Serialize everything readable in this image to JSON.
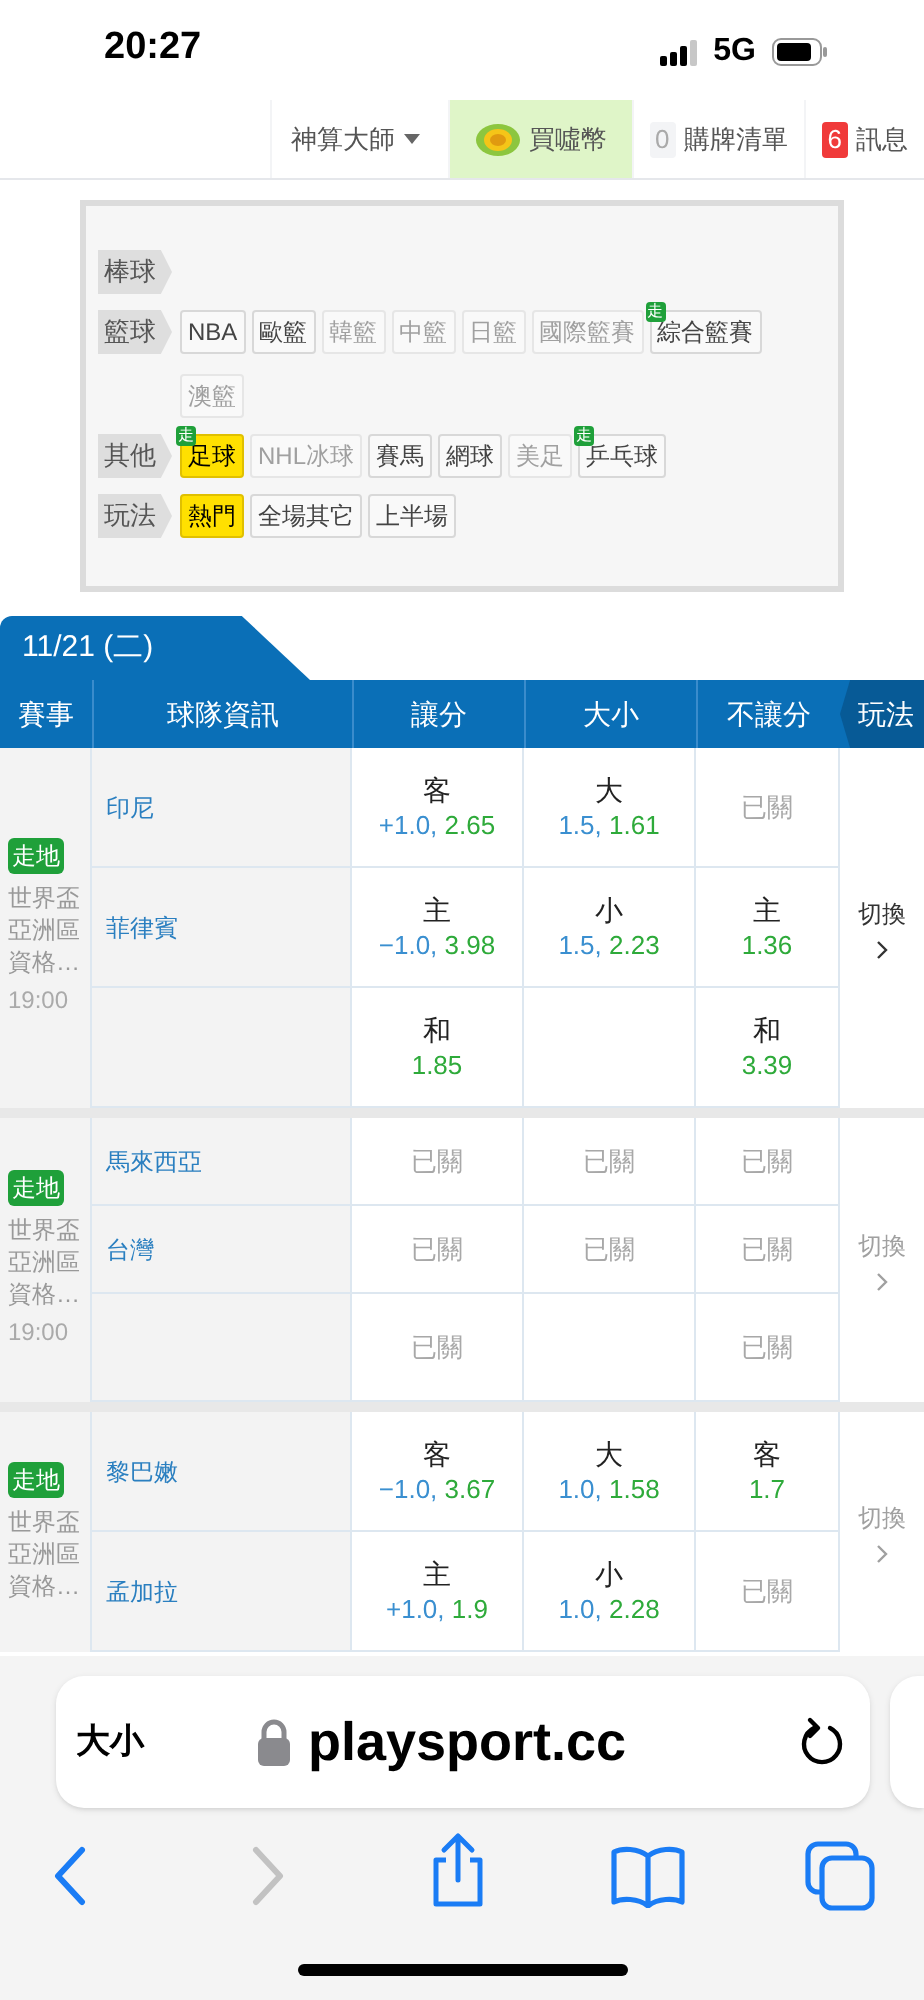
{
  "status_bar": {
    "time": "20:27",
    "network": "5G"
  },
  "nav": [
    {
      "kind": "menu",
      "label": "神算大師",
      "selected": false
    },
    {
      "kind": "coin",
      "label": "買噓幣",
      "selected": true
    },
    {
      "kind": "count",
      "count": "0",
      "label": "購牌清單",
      "alert": false,
      "selected": false
    },
    {
      "kind": "count",
      "count": "6",
      "label": "訊息",
      "alert": true,
      "selected": false
    }
  ],
  "filters": [
    {
      "category": "棒球"
    },
    {
      "category": "籃球",
      "chips": [
        {
          "label": "NBA",
          "selected": false,
          "disabled": false
        },
        {
          "label": "歐籃",
          "selected": false,
          "disabled": false
        },
        {
          "label": "韓籃",
          "selected": false,
          "disabled": true
        },
        {
          "label": "中籃",
          "selected": false,
          "disabled": true
        },
        {
          "label": "日籃",
          "selected": false,
          "disabled": true
        },
        {
          "label": "國際籃賽",
          "selected": false,
          "disabled": true
        },
        {
          "label": "綜合籃賽",
          "selected": false,
          "disabled": false,
          "live_badge": "走"
        },
        {
          "label": "澳籃",
          "selected": false,
          "disabled": true
        }
      ]
    },
    {
      "category": "其他",
      "chips": [
        {
          "label": "足球",
          "selected": true,
          "disabled": false,
          "live_badge": "走"
        },
        {
          "label": "NHL冰球",
          "selected": false,
          "disabled": true
        },
        {
          "label": "賽馬",
          "selected": false,
          "disabled": false
        },
        {
          "label": "網球",
          "selected": false,
          "disabled": false
        },
        {
          "label": "美足",
          "selected": false,
          "disabled": true
        },
        {
          "label": "乒乓球",
          "selected": false,
          "disabled": false,
          "live_badge": "走"
        }
      ]
    },
    {
      "category": "玩法",
      "chips": [
        {
          "label": "熱門",
          "selected": true,
          "disabled": false
        },
        {
          "label": "全場其它",
          "selected": false,
          "disabled": false
        },
        {
          "label": "上半場",
          "selected": false,
          "disabled": false
        }
      ]
    }
  ],
  "date_tab": "11/21 (二)",
  "table": {
    "columns": [
      "賽事",
      "球隊資訊",
      "讓分",
      "大小",
      "不讓分",
      "玩法"
    ],
    "matches": [
      {
        "badge": "走地",
        "league": "世界盃亞洲區資格…",
        "time": "19:00",
        "switch": {
          "label": "切換",
          "enabled": true
        },
        "rows": [
          {
            "team": "印尼",
            "cells": [
              {
                "kind": "odds",
                "label": "客",
                "line": "+1.0,",
                "odds": "2.65"
              },
              {
                "kind": "odds",
                "label": "大",
                "line": "1.5,",
                "odds": "1.61"
              },
              {
                "kind": "closed",
                "text": "已關"
              }
            ]
          },
          {
            "team": "菲律賓",
            "cells": [
              {
                "kind": "odds",
                "label": "主",
                "line": "−1.0,",
                "odds": "3.98"
              },
              {
                "kind": "odds",
                "label": "小",
                "line": "1.5,",
                "odds": "2.23"
              },
              {
                "kind": "odds",
                "label": "主",
                "odds": "1.36"
              }
            ]
          },
          {
            "cells": [
              {
                "kind": "odds",
                "label": "和",
                "odds": "1.85"
              },
              {
                "kind": "empty"
              },
              {
                "kind": "odds",
                "label": "和",
                "odds": "3.39"
              }
            ]
          }
        ]
      },
      {
        "badge": "走地",
        "league": "世界盃亞洲區資格…",
        "time": "19:00",
        "switch": {
          "label": "切換",
          "enabled": false
        },
        "rows": [
          {
            "team": "馬來西亞",
            "cells": [
              {
                "kind": "closed",
                "text": "已關"
              },
              {
                "kind": "closed",
                "text": "已關"
              },
              {
                "kind": "closed",
                "text": "已關"
              }
            ]
          },
          {
            "team": "台灣",
            "cells": [
              {
                "kind": "closed",
                "text": "已關"
              },
              {
                "kind": "closed",
                "text": "已關"
              },
              {
                "kind": "closed",
                "text": "已關"
              }
            ]
          },
          {
            "cells": [
              {
                "kind": "closed",
                "text": "已關"
              },
              {
                "kind": "empty"
              },
              {
                "kind": "closed",
                "text": "已關"
              }
            ]
          }
        ]
      },
      {
        "badge": "走地",
        "league": "世界盃亞洲區資格…",
        "switch": {
          "label": "切換",
          "enabled": false
        },
        "rows": [
          {
            "team": "黎巴嫩",
            "cells": [
              {
                "kind": "odds",
                "label": "客",
                "line": "−1.0,",
                "odds": "3.67"
              },
              {
                "kind": "odds",
                "label": "大",
                "line": "1.0,",
                "odds": "1.58"
              },
              {
                "kind": "odds",
                "label": "客",
                "odds": "1.7"
              }
            ]
          },
          {
            "team": "孟加拉",
            "cells": [
              {
                "kind": "odds",
                "label": "主",
                "line": "+1.0,",
                "odds": "1.9"
              },
              {
                "kind": "odds",
                "label": "小",
                "line": "1.0,",
                "odds": "2.28"
              },
              {
                "kind": "closed",
                "text": "已關"
              }
            ]
          }
        ]
      }
    ]
  },
  "browser": {
    "text_size": "大小",
    "url": "playsport.cc",
    "forward_enabled": false
  }
}
